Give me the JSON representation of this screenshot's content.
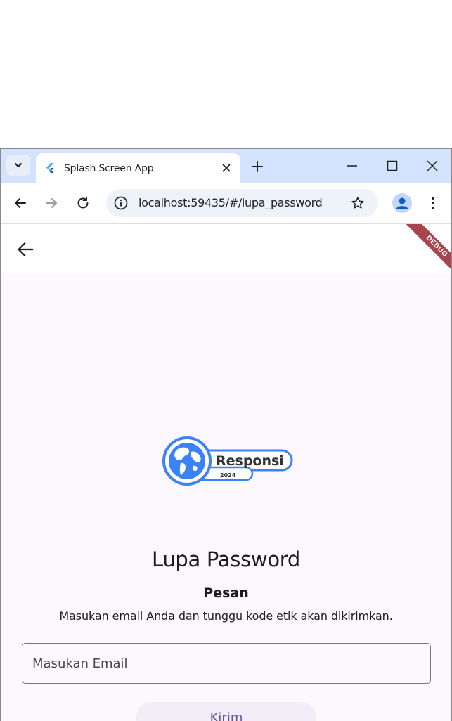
{
  "browser": {
    "tab_title": "Splash Screen App",
    "url": "localhost:59435/#/lupa_password"
  },
  "app": {
    "debug_banner": "DEBUG",
    "logo": {
      "word": "Responsi",
      "year": "2024"
    },
    "title": "Lupa Password",
    "subtitle": "Pesan",
    "message": "Masukan email Anda dan tunggu kode etik akan dikirimkan.",
    "email_placeholder": "Masukan Email",
    "submit_label": "Kirim"
  },
  "colors": {
    "tabstrip": "#d3e3fd",
    "app_background": "#fdf7fe",
    "logo_blue": "#3b82f6",
    "button_text": "#6750a4",
    "debug_ribbon": "#a8454c"
  }
}
